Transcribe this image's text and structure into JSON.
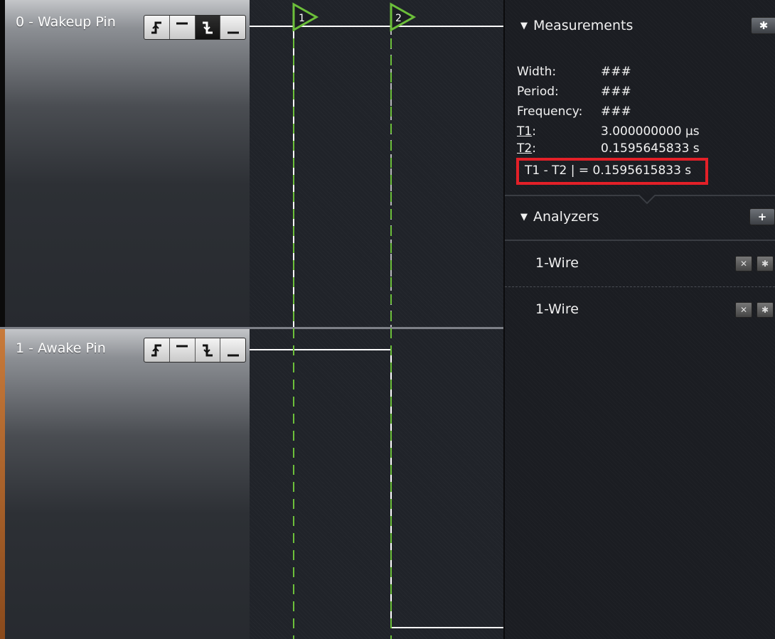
{
  "channels": [
    {
      "name": "0 - Wakeup Pin",
      "active_trigger": 2
    },
    {
      "name": "1 - Awake Pin",
      "active_trigger": -1
    }
  ],
  "markers": [
    {
      "label": "1"
    },
    {
      "label": "2"
    }
  ],
  "measurements": {
    "header": "Measurements",
    "width_label": "Width:",
    "width_value": "###",
    "period_label": "Period:",
    "period_value": "###",
    "frequency_label": "Frequency:",
    "frequency_value": "###",
    "t1_label": "T1",
    "t1_colon": ":",
    "t1_value": "3.000000000 µs",
    "t2_label": "T2",
    "t2_colon": ":",
    "t2_value": "0.1595645833 s",
    "diff_text": "T1 - T2 | = 0.1595615833 s"
  },
  "analyzers": {
    "header": "Analyzers",
    "items": [
      {
        "label": "1-Wire"
      },
      {
        "label": "1-Wire"
      }
    ]
  },
  "colors": {
    "marker": "#6cbf3a",
    "highlight": "#e32028",
    "signal": "#ffffff"
  },
  "icons": {
    "settings": "gear-icon",
    "add": "plus-icon",
    "remove": "close-icon",
    "collapse": "triangle-down-icon"
  }
}
